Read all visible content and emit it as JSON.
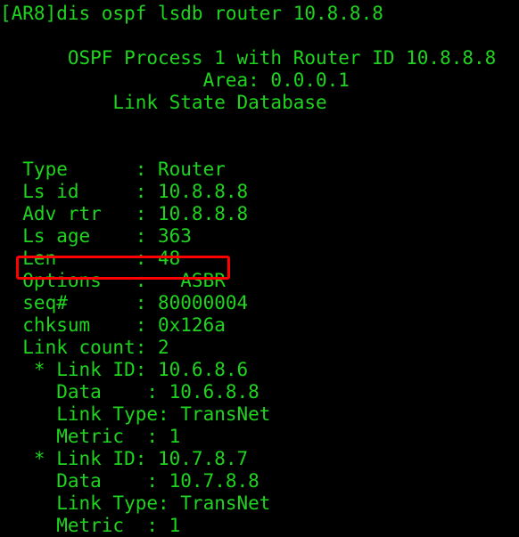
{
  "terminal": {
    "background_color": "#000000",
    "text_color": "#1fd41f",
    "highlight_color": "#ff0000",
    "prompt_line": "[AR8]dis ospf lsdb router 10.8.8.8",
    "lines": [
      "[AR8]dis ospf lsdb router 10.8.8.8",
      "",
      "      OSPF Process 1 with Router ID 10.8.8.8",
      "                  Area: 0.0.0.1",
      "          Link State Database",
      "",
      "",
      "  Type      : Router",
      "  Ls id     : 10.8.8.8",
      "  Adv rtr   : 10.8.8.8",
      "  Ls age    : 363",
      "  Len       : 48",
      "  Options   :   ASBR",
      "  seq#      : 80000004",
      "  chksum    : 0x126a",
      "  Link count: 2",
      "   * Link ID: 10.6.8.6",
      "     Data    : 10.6.8.8",
      "     Link Type: TransNet",
      "     Metric  : 1",
      "   * Link ID: 10.7.8.7",
      "     Data    : 10.7.8.8",
      "     Link Type: TransNet",
      "     Metric  : 1"
    ],
    "fields": {
      "type_label": "Type",
      "type_value": "Router",
      "ls_id_label": "Ls id",
      "ls_id_value": "10.8.8.8",
      "adv_rtr_label": "Adv rtr",
      "adv_rtr_value": "10.8.8.8",
      "ls_age_label": "Ls age",
      "ls_age_value": "363",
      "len_label": "Len",
      "len_value": "48",
      "options_label": "Options",
      "options_value": "ASBR",
      "seq_label": "seq#",
      "seq_value": "80000004",
      "chksum_label": "chksum",
      "chksum_value": "0x126a",
      "link_count_label": "Link count",
      "link_count_value": "2"
    },
    "header": {
      "process_line": "OSPF Process 1 with Router ID 10.8.8.8",
      "area_line": "Area: 0.0.0.1",
      "database_line": "Link State Database",
      "process_id": "1",
      "router_id": "10.8.8.8",
      "area": "0.0.0.1"
    },
    "links": [
      {
        "link_id_label": "Link ID",
        "link_id_value": "10.6.8.6",
        "data_label": "Data",
        "data_value": "10.6.8.8",
        "link_type_label": "Link Type",
        "link_type_value": "TransNet",
        "metric_label": "Metric",
        "metric_value": "1"
      },
      {
        "link_id_label": "Link ID",
        "link_id_value": "10.7.8.7",
        "data_label": "Data",
        "data_value": "10.7.8.8",
        "link_type_label": "Link Type",
        "link_type_value": "TransNet",
        "metric_label": "Metric",
        "metric_value": "1"
      }
    ]
  }
}
